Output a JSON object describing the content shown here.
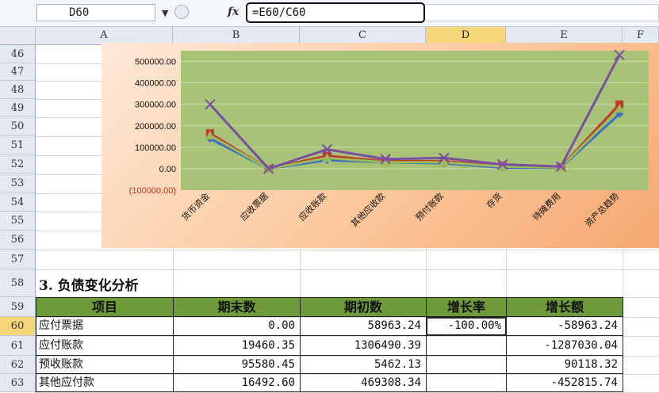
{
  "formula_bar": {
    "name_box": "D60",
    "fx": "fx",
    "formula": "=E60/C60"
  },
  "columns": [
    "A",
    "B",
    "C",
    "D",
    "E",
    "F"
  ],
  "selected_column": "D",
  "rows": [
    "46",
    "47",
    "48",
    "49",
    "50",
    "51",
    "52",
    "53",
    "54",
    "55",
    "56",
    "57",
    "58",
    "59",
    "60",
    "61",
    "62",
    "63"
  ],
  "selected_row": "60",
  "chart_data": {
    "type": "line",
    "categories": [
      "货币资金",
      "应收票据",
      "应收账款",
      "其他应收款",
      "预付账款",
      "存货",
      "待摊费用",
      "资产总趋势"
    ],
    "y_ticks": [
      "500000.00",
      "400000.00",
      "300000.00",
      "200000.00",
      "100000.00",
      "0.00",
      "(100000.00)"
    ],
    "ylim": [
      -100000,
      550000
    ],
    "grid": true,
    "series": [
      {
        "color": "#3b6fc4",
        "marker": "diamond",
        "values": [
          140000,
          0,
          40000,
          30000,
          25000,
          5000,
          5000,
          255000
        ]
      },
      {
        "color": "#c0392b",
        "marker": "square",
        "values": [
          165000,
          0,
          60000,
          35000,
          35000,
          15000,
          8000,
          300000
        ]
      },
      {
        "color": "#9bbb59",
        "marker": "triangle",
        "values": [
          155000,
          0,
          50000,
          30000,
          30000,
          10000,
          6000,
          280000
        ]
      },
      {
        "color": "#7a4fa0",
        "marker": "x",
        "values": [
          300000,
          0,
          90000,
          45000,
          50000,
          20000,
          10000,
          530000
        ]
      }
    ],
    "negative_tick_color": "#e0271f"
  },
  "section_title": "3. 负债变化分析",
  "table": {
    "headers": [
      "项目",
      "期末数",
      "期初数",
      "增长率",
      "增长额"
    ],
    "rows": [
      [
        "应付票据",
        "0.00",
        "58963.24",
        "-100.00%",
        "-58963.24"
      ],
      [
        "应付账款",
        "19460.35",
        "1306490.39",
        "",
        "-1287030.04"
      ],
      [
        "预收账款",
        "95580.45",
        "5462.13",
        "",
        "90118.32"
      ],
      [
        "其他应付款",
        "16492.60",
        "469308.34",
        "",
        "-452815.74"
      ]
    ]
  }
}
